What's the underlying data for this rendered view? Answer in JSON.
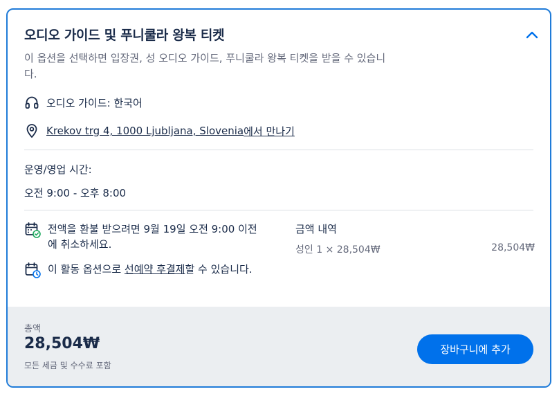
{
  "option": {
    "title": "오디오 가이드 및 푸니쿨라 왕복 티켓",
    "description": "이 옵션을 선택하면 입장권, 성 오디오 가이드, 푸니쿨라 왕복 티켓을 받을 수 있습니다.",
    "audio_guide": "오디오 가이드: 한국어",
    "meeting_address": "Krekov trg 4, 1000 Ljubljana, Slovenia",
    "meeting_suffix": "에서 만나기"
  },
  "hours": {
    "title": "운영/영업 시간:",
    "value": "오전 9:00 - 오후 8:00"
  },
  "policies": {
    "cancel": "전액을 환불 받으려면 9월 19일 오전 9:00 이전에 취소하세요.",
    "pay_prefix": "이 활동 옵션으로 ",
    "pay_link": "선예약 후결제",
    "pay_suffix": "할 수 있습니다."
  },
  "price": {
    "title": "금액 내역",
    "line_label": "성인 1 × 28,504₩",
    "line_amount": "28,504₩"
  },
  "footer": {
    "total_label": "총액",
    "total_value": "28,504₩",
    "total_note": "모든 세금 및 수수료 포함",
    "cart_button": "장바구니에 추가"
  },
  "colors": {
    "accent": "#0071eb",
    "border": "#1f7bd8",
    "text": "#1a2b49",
    "muted": "#63687a",
    "footer_bg": "#ebeef1",
    "check_green": "#1aa85c"
  },
  "icons": {
    "collapse": "chevron-up-icon",
    "audio": "headphones-icon",
    "meeting": "location-pin-icon",
    "cancel": "calendar-check-icon",
    "pay": "calendar-clock-icon"
  }
}
